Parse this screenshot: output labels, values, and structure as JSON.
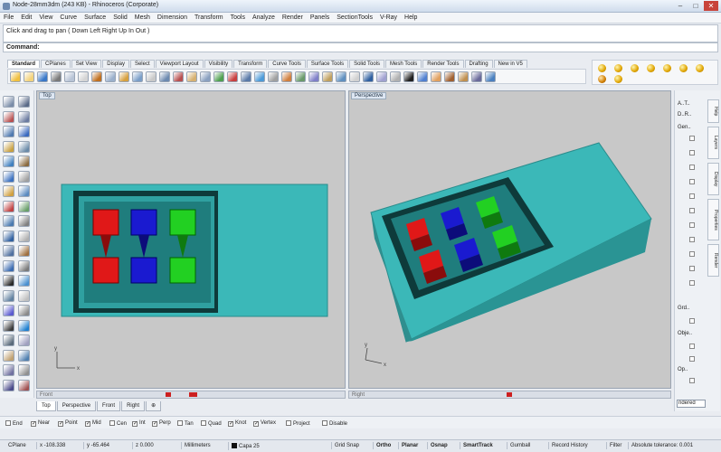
{
  "window": {
    "title": "Node-28mm3dm (243 KB) - Rhinoceros (Corporate)",
    "minimize_glyph": "–",
    "maximize_glyph": "□",
    "close_glyph": "✕"
  },
  "menu": [
    "File",
    "Edit",
    "View",
    "Curve",
    "Surface",
    "Solid",
    "Mesh",
    "Dimension",
    "Transform",
    "Tools",
    "Analyze",
    "Render",
    "Panels",
    "SectionTools",
    "V-Ray",
    "Help"
  ],
  "command_history": "Click and drag to pan ( Down  Left  Right  Up  In  Out )",
  "command_label": "Command:",
  "toolbar_tabs": [
    "Standard",
    "CPlanes",
    "Set View",
    "Display",
    "Select",
    "Viewport Layout",
    "Visibility",
    "Transform",
    "Curve Tools",
    "Surface Tools",
    "Solid Tools",
    "Mesh Tools",
    "Render Tools",
    "Drafting",
    "New in V5"
  ],
  "viewports": {
    "top": {
      "title": "Top",
      "scroll_label": "Front",
      "axis_x": "x",
      "axis_y": "y"
    },
    "perspective": {
      "title": "Perspective",
      "scroll_label": "Right",
      "axis_x": "x",
      "axis_y": "y"
    }
  },
  "view_tabs": [
    "Top",
    "Perspective",
    "Front",
    "Right",
    "⊕"
  ],
  "right_panel": {
    "labels": [
      "A..T..",
      "D..R..",
      "Gen..",
      "Grd..",
      "Obje..",
      "Op.."
    ],
    "vertical_tabs": [
      "Help",
      "Layers",
      "Display",
      "Properties",
      "Render"
    ],
    "dropdown_value": "ndered"
  },
  "osnap": [
    {
      "label": "End",
      "checked": false
    },
    {
      "label": "Near",
      "checked": true
    },
    {
      "label": "Point",
      "checked": true
    },
    {
      "label": "Mid",
      "checked": true
    },
    {
      "label": "Cen",
      "checked": false
    },
    {
      "label": "Int",
      "checked": true
    },
    {
      "label": "Perp",
      "checked": true
    },
    {
      "label": "Tan",
      "checked": false
    },
    {
      "label": "Quad",
      "checked": false
    },
    {
      "label": "Knot",
      "checked": true
    },
    {
      "label": "Vertex",
      "checked": true
    },
    {
      "label": "Project",
      "checked": false
    },
    {
      "label": "Disable",
      "checked": false
    }
  ],
  "status": {
    "cplane": "CPlane",
    "x": "x -108.338",
    "y": "y -65.464",
    "z": "z 0.000",
    "units": "Millimeters",
    "layer": "Capa 25",
    "toggles": [
      "Grid Snap",
      "Ortho",
      "Planar",
      "Osnap",
      "SmartTrack",
      "Gumball",
      "Record History",
      "Filter"
    ],
    "bold_toggles": [
      "Ortho",
      "Planar",
      "Osnap",
      "SmartTrack"
    ],
    "tolerance": "Absolute tolerance: 0.001"
  },
  "colors": {
    "model_teal": "#3bb8b8",
    "cube_red": "#e01818",
    "cube_blue": "#1a1ad0",
    "cube_green": "#22d022",
    "viewport_bg": "#c8c8c8"
  }
}
